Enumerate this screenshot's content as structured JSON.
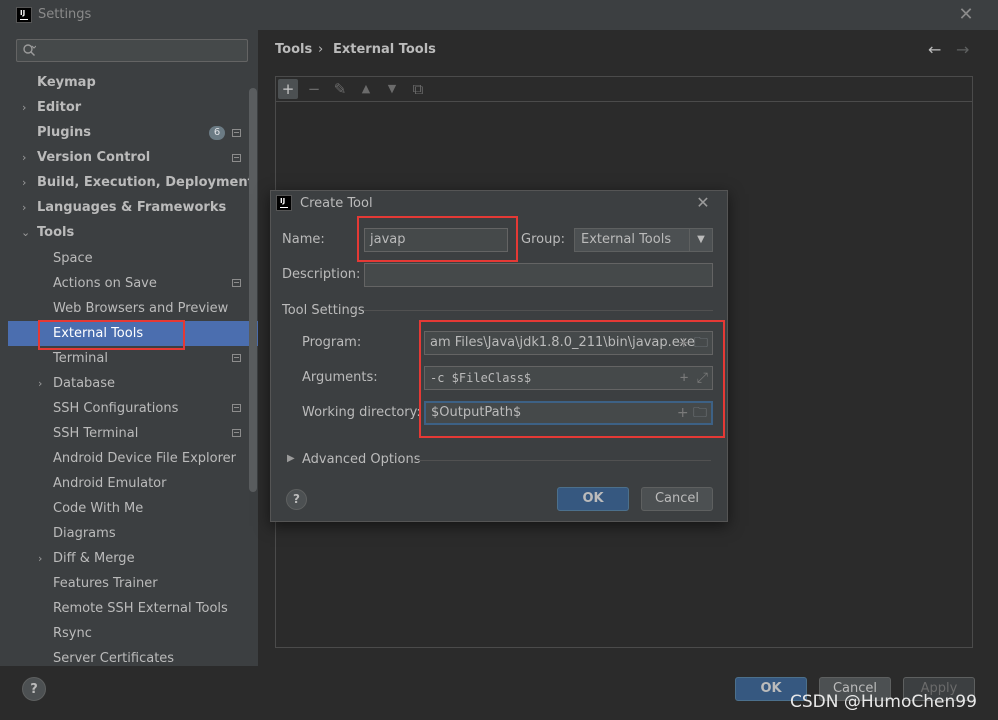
{
  "window": {
    "title": "Settings"
  },
  "search": {
    "placeholder": ""
  },
  "sidebar": {
    "items": [
      {
        "label": "Keymap"
      },
      {
        "label": "Editor"
      },
      {
        "label": "Plugins",
        "badge": "6"
      },
      {
        "label": "Version Control"
      },
      {
        "label": "Build, Execution, Deployment"
      },
      {
        "label": "Languages & Frameworks"
      },
      {
        "label": "Tools"
      },
      {
        "label": "Space"
      },
      {
        "label": "Actions on Save"
      },
      {
        "label": "Web Browsers and Preview"
      },
      {
        "label": "External Tools"
      },
      {
        "label": "Terminal"
      },
      {
        "label": "Database"
      },
      {
        "label": "SSH Configurations"
      },
      {
        "label": "SSH Terminal"
      },
      {
        "label": "Android Device File Explorer"
      },
      {
        "label": "Android Emulator"
      },
      {
        "label": "Code With Me"
      },
      {
        "label": "Diagrams"
      },
      {
        "label": "Diff & Merge"
      },
      {
        "label": "Features Trainer"
      },
      {
        "label": "Remote SSH External Tools"
      },
      {
        "label": "Rsync"
      },
      {
        "label": "Server Certificates"
      }
    ]
  },
  "breadcrumb": {
    "parent": "Tools",
    "separator": "›",
    "current": "External Tools"
  },
  "footer": {
    "help": "?",
    "ok": "OK",
    "cancel": "Cancel",
    "apply": "Apply"
  },
  "dialog": {
    "title": "Create Tool",
    "name_label": "Name:",
    "name_value": "javap",
    "group_label": "Group:",
    "group_value": "External Tools",
    "description_label": "Description:",
    "description_value": "",
    "section": "Tool Settings",
    "program_label": "Program:",
    "program_value": "am Files\\Java\\jdk1.8.0_211\\bin\\javap.exe",
    "arguments_label": "Arguments:",
    "arguments_value": "-c $FileClass$",
    "workdir_label": "Working directory:",
    "workdir_value": "$OutputPath$",
    "advanced": "Advanced Options",
    "help": "?",
    "ok": "OK",
    "cancel": "Cancel"
  },
  "watermark": "CSDN @HumoChen99",
  "colors": {
    "accent": "#4b6eaf",
    "highlight": "#e53935",
    "primary_button": "#365880"
  }
}
